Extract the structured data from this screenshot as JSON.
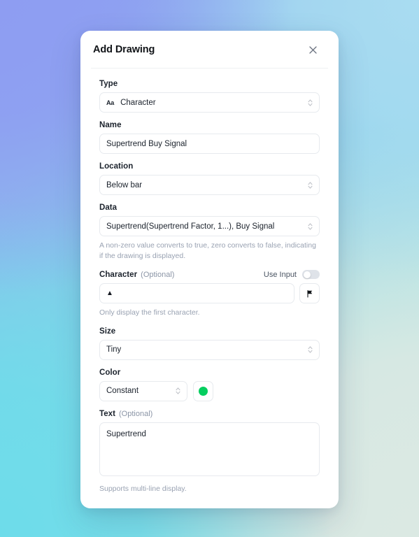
{
  "modal": {
    "title": "Add Drawing",
    "close_icon": "close-icon"
  },
  "fields": {
    "type": {
      "label": "Type",
      "icon": "Aa",
      "value": "Character"
    },
    "name": {
      "label": "Name",
      "value": "Supertrend Buy Signal"
    },
    "location": {
      "label": "Location",
      "value": "Below bar"
    },
    "data": {
      "label": "Data",
      "value": "Supertrend(Supertrend Factor, 1...), Buy Signal",
      "helper": "A non-zero value converts to true, zero converts to false, indicating if the drawing is displayed."
    },
    "character": {
      "label": "Character",
      "optional": "(Optional)",
      "use_input_label": "Use Input",
      "use_input_state": "off",
      "value": "▲",
      "flag_icon": "flag-icon",
      "helper": "Only display the first character."
    },
    "size": {
      "label": "Size",
      "value": "Tiny"
    },
    "color": {
      "label": "Color",
      "value": "Constant",
      "swatch_color": "#05ce5f"
    },
    "text": {
      "label": "Text",
      "optional": "(Optional)",
      "value": "Supertrend",
      "helper": "Supports multi-line display."
    }
  }
}
